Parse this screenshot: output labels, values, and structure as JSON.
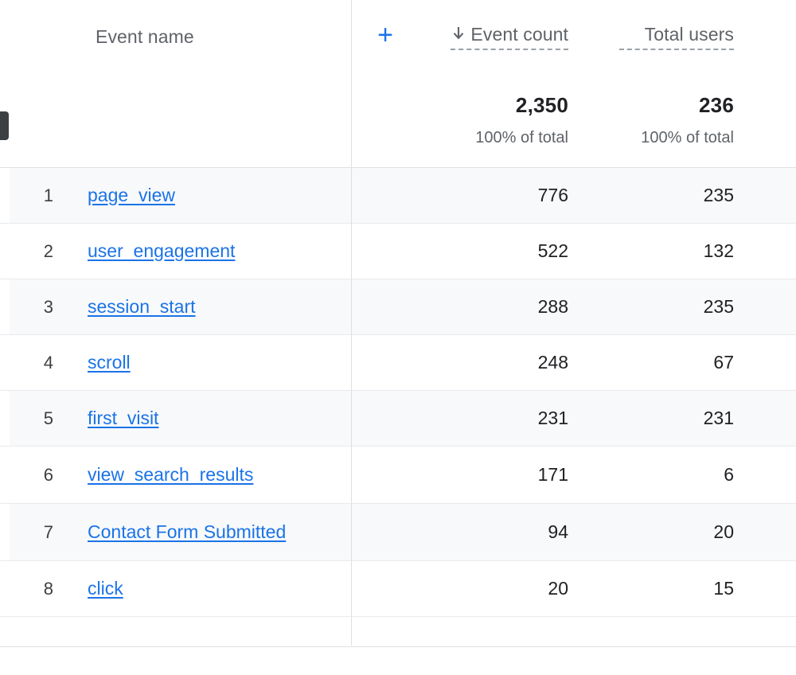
{
  "panel": {
    "handle_name": "collapsed-panel-handle"
  },
  "table": {
    "header": {
      "dimension_label": "Event name",
      "add_dimension_icon": "plus-icon",
      "sort_icon": "arrow-down-icon",
      "metrics": [
        {
          "label": "Event count",
          "sorted": true
        },
        {
          "label": "Total users",
          "sorted": false
        }
      ]
    },
    "totals": [
      {
        "value": "2,350",
        "subtext": "100% of total"
      },
      {
        "value": "236",
        "subtext": "100% of total"
      }
    ],
    "rows": [
      {
        "rank": "1",
        "event_name": "page_view",
        "event_count": "776",
        "total_users": "235"
      },
      {
        "rank": "2",
        "event_name": "user_engagement",
        "event_count": "522",
        "total_users": "132"
      },
      {
        "rank": "3",
        "event_name": "session_start",
        "event_count": "288",
        "total_users": "235"
      },
      {
        "rank": "4",
        "event_name": "scroll",
        "event_count": "248",
        "total_users": "67"
      },
      {
        "rank": "5",
        "event_name": "first_visit",
        "event_count": "231",
        "total_users": "231"
      },
      {
        "rank": "6",
        "event_name": "view_search_results",
        "event_count": "171",
        "total_users": "6"
      },
      {
        "rank": "7",
        "event_name": "Contact Form Submitted",
        "event_count": "94",
        "total_users": "20"
      },
      {
        "rank": "8",
        "event_name": "click",
        "event_count": "20",
        "total_users": "15"
      }
    ]
  },
  "colors": {
    "link": "#1a73e8",
    "accent": "#1a73e8",
    "text_primary": "#202124",
    "text_secondary": "#5f6368",
    "row_stripe": "#f8f9fa",
    "border": "#e0e0e0",
    "handle": "#3c4043"
  }
}
